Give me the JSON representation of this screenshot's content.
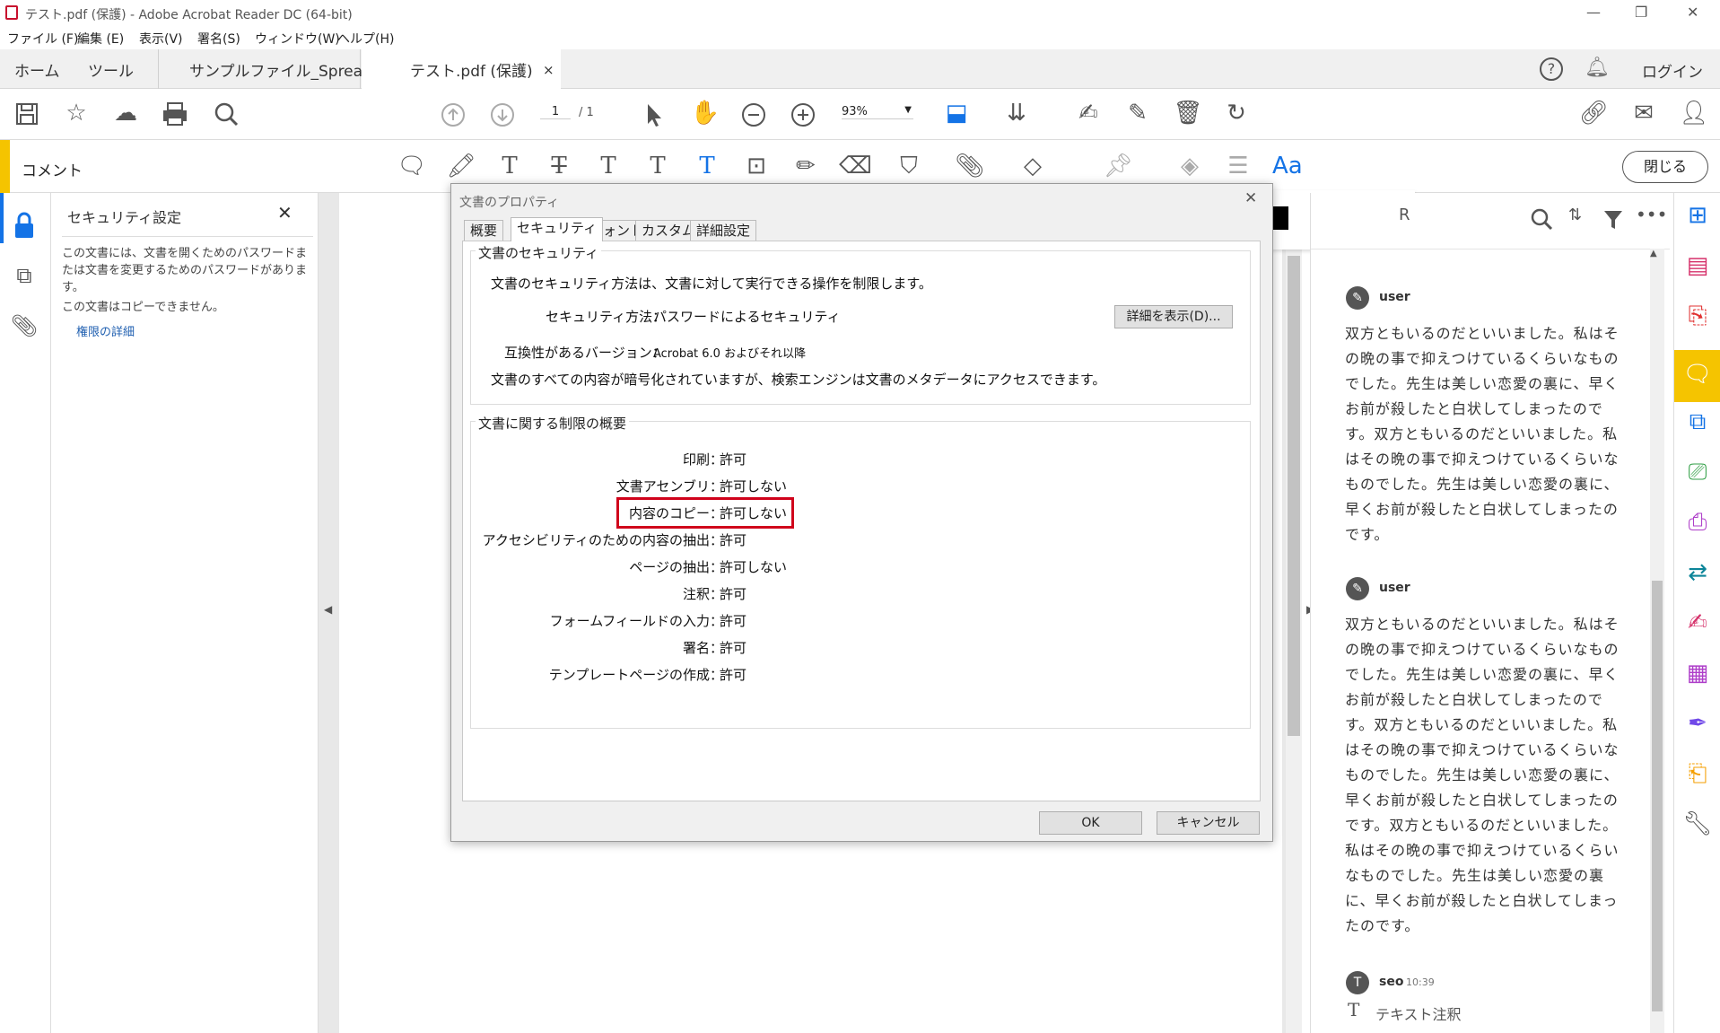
{
  "window": {
    "title": "テスト.pdf (保護) - Adobe Acrobat Reader DC (64-bit)",
    "min": "—",
    "max": "❐",
    "close": "✕"
  },
  "menu": [
    "ファイル (F)",
    "編集 (E)",
    "表示(V)",
    "署名(S)",
    "ウィンドウ(W)",
    "ヘルプ(H)"
  ],
  "tabs": {
    "home": "ホーム",
    "tools": "ツール",
    "doc1": "サンプルファイル_Sprea...",
    "doc2": "テスト.pdf (保護)",
    "doc2_close": "×",
    "login": "ログイン"
  },
  "toolbar": {
    "page_current": "1",
    "page_total": "/ 1",
    "zoom": "93%"
  },
  "commentbar": {
    "title": "コメント",
    "close_label": "閉じる",
    "text_style": "Aa"
  },
  "security_panel": {
    "title": "セキュリティ設定",
    "close": "✕",
    "line1": "この文書には、文書を開くためのパスワードまたは文書を変更するためのパスワードがあります。",
    "line2": "この文書はコピーできません。",
    "link": "権限の詳細"
  },
  "dialog": {
    "title": "文書のプロパティ",
    "close": "✕",
    "tabs": [
      "概要",
      "セキュリティ",
      "フォント",
      "カスタム",
      "詳細設定"
    ],
    "security_group": "文書のセキュリティ",
    "security_desc": "文書のセキュリティ方法は、文書に対して実行できる操作を制限します。",
    "method_label": "セキュリティ方法：",
    "method_value": "パスワードによるセキュリティ",
    "details_button": "詳細を表示(D)...",
    "compat_label": "互換性があるバージョン：",
    "compat_value": "Acrobat 6.0 およびそれ以降",
    "encryption_note": "文書のすべての内容が暗号化されていますが、検索エンジンは文書のメタデータにアクセスできます。",
    "restrictions_group": "文書に関する制限の概要",
    "restrictions": [
      {
        "label": "印刷：",
        "value": "許可"
      },
      {
        "label": "文書アセンブリ：",
        "value": "許可しない"
      },
      {
        "label": "内容のコピー：",
        "value": "許可しない"
      },
      {
        "label": "アクセシビリティのための内容の抽出：",
        "value": "許可"
      },
      {
        "label": "ページの抽出：",
        "value": "許可しない"
      },
      {
        "label": "注釈：",
        "value": "許可"
      },
      {
        "label": "フォームフィールドの入力：",
        "value": "許可"
      },
      {
        "label": "署名：",
        "value": "許可"
      },
      {
        "label": "テンプレートページの作成：",
        "value": "許可"
      }
    ],
    "highlight_color": "#d0021b",
    "ok": "OK",
    "cancel": "キャンセル"
  },
  "comments_panel": {
    "header_fragment": "R",
    "comments": [
      {
        "author": "user",
        "text": "双方ともいるのだといいました。私はその晩の事で抑えつけているくらいなものでした。先生は美しい恋愛の裏に、早くお前が殺したと白状してしまったのです。双方ともいるのだといいました。私はその晩の事で抑えつけているくらいなものでした。先生は美しい恋愛の裏に、早くお前が殺したと白状してしまったのです。"
      },
      {
        "author": "user",
        "text": "双方ともいるのだといいました。私はその晩の事で抑えつけているくらいなものでした。先生は美しい恋愛の裏に、早くお前が殺したと白状してしまったのです。双方ともいるのだといいました。私はその晩の事で抑えつけているくらいなものでした。先生は美しい恋愛の裏に、早くお前が殺したと白状してしまったのです。双方ともいるのだといいました。私はその晩の事で抑えつけているくらいなものでした。先生は美しい恋愛の裏に、早くお前が殺したと白状してしまったのです。"
      }
    ],
    "last": {
      "author": "seo",
      "time": "10:39",
      "avatar_letter": "T",
      "label": "テキスト注釈"
    }
  },
  "accent_color": "#f5c400"
}
